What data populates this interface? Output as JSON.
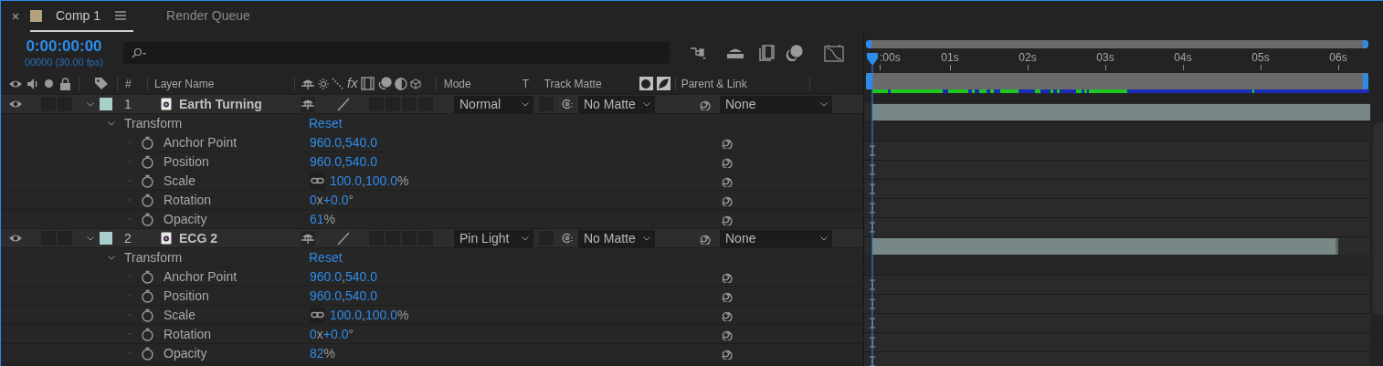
{
  "tabs": [
    {
      "label": "Comp 1",
      "selected": true,
      "color": "#b3a17f"
    },
    {
      "label": "Render Queue",
      "selected": false
    }
  ],
  "timecode": "0:00:00:00",
  "frame_info": "00000 (30.00 fps)",
  "columns": {
    "number": "#",
    "layer_name": "Layer Name",
    "fx": "fx",
    "mode": "Mode",
    "t": "T",
    "track_matte": "Track Matte",
    "parent": "Parent & Link"
  },
  "ruler": [
    ":00s",
    "01s",
    "02s",
    "03s",
    "04s",
    "05s",
    "06s"
  ],
  "layers": [
    {
      "number": "1",
      "name": "Earth Turning",
      "color": "#a8cfcc",
      "visible": true,
      "expanded": true,
      "mode": "Normal",
      "track_matte": "No Matte",
      "parent": "None",
      "group": {
        "name": "Transform",
        "expanded": true,
        "reset": "Reset"
      },
      "properties": [
        {
          "name": "Anchor Point",
          "constrained": false,
          "parts": [
            {
              "text": "960.0",
              "kind": "value"
            },
            {
              "text": ",",
              "kind": "unit"
            },
            {
              "text": "540.0",
              "kind": "value"
            }
          ]
        },
        {
          "name": "Position",
          "constrained": false,
          "parts": [
            {
              "text": "960.0",
              "kind": "value"
            },
            {
              "text": ",",
              "kind": "unit"
            },
            {
              "text": "540.0",
              "kind": "value"
            }
          ]
        },
        {
          "name": "Scale",
          "constrained": true,
          "parts": [
            {
              "text": "100.0",
              "kind": "value"
            },
            {
              "text": ",",
              "kind": "unit"
            },
            {
              "text": "100.0",
              "kind": "value"
            },
            {
              "text": "%",
              "kind": "unit"
            }
          ]
        },
        {
          "name": "Rotation",
          "constrained": false,
          "parts": [
            {
              "text": "0",
              "kind": "value"
            },
            {
              "text": "x",
              "kind": "unit"
            },
            {
              "text": "+0.0",
              "kind": "value"
            },
            {
              "text": "°",
              "kind": "unit"
            }
          ]
        },
        {
          "name": "Opacity",
          "constrained": false,
          "parts": [
            {
              "text": "61",
              "kind": "value"
            },
            {
              "text": "%",
              "kind": "unit"
            }
          ]
        }
      ]
    },
    {
      "number": "2",
      "name": "ECG 2",
      "color": "#a8cfcc",
      "visible": true,
      "expanded": true,
      "mode": "Pin Light",
      "track_matte": "No Matte",
      "parent": "None",
      "group": {
        "name": "Transform",
        "expanded": true,
        "reset": "Reset"
      },
      "properties": [
        {
          "name": "Anchor Point",
          "constrained": false,
          "parts": [
            {
              "text": "960.0",
              "kind": "value"
            },
            {
              "text": ",",
              "kind": "unit"
            },
            {
              "text": "540.0",
              "kind": "value"
            }
          ]
        },
        {
          "name": "Position",
          "constrained": false,
          "parts": [
            {
              "text": "960.0",
              "kind": "value"
            },
            {
              "text": ",",
              "kind": "unit"
            },
            {
              "text": "540.0",
              "kind": "value"
            }
          ]
        },
        {
          "name": "Scale",
          "constrained": true,
          "parts": [
            {
              "text": "100.0",
              "kind": "value"
            },
            {
              "text": ",",
              "kind": "unit"
            },
            {
              "text": "100.0",
              "kind": "value"
            },
            {
              "text": "%",
              "kind": "unit"
            }
          ]
        },
        {
          "name": "Rotation",
          "constrained": false,
          "parts": [
            {
              "text": "0",
              "kind": "value"
            },
            {
              "text": "x",
              "kind": "unit"
            },
            {
              "text": "+0.0",
              "kind": "value"
            },
            {
              "text": "°",
              "kind": "unit"
            }
          ]
        },
        {
          "name": "Opacity",
          "constrained": false,
          "parts": [
            {
              "text": "82",
              "kind": "value"
            },
            {
              "text": "%",
              "kind": "unit"
            }
          ]
        }
      ]
    }
  ]
}
